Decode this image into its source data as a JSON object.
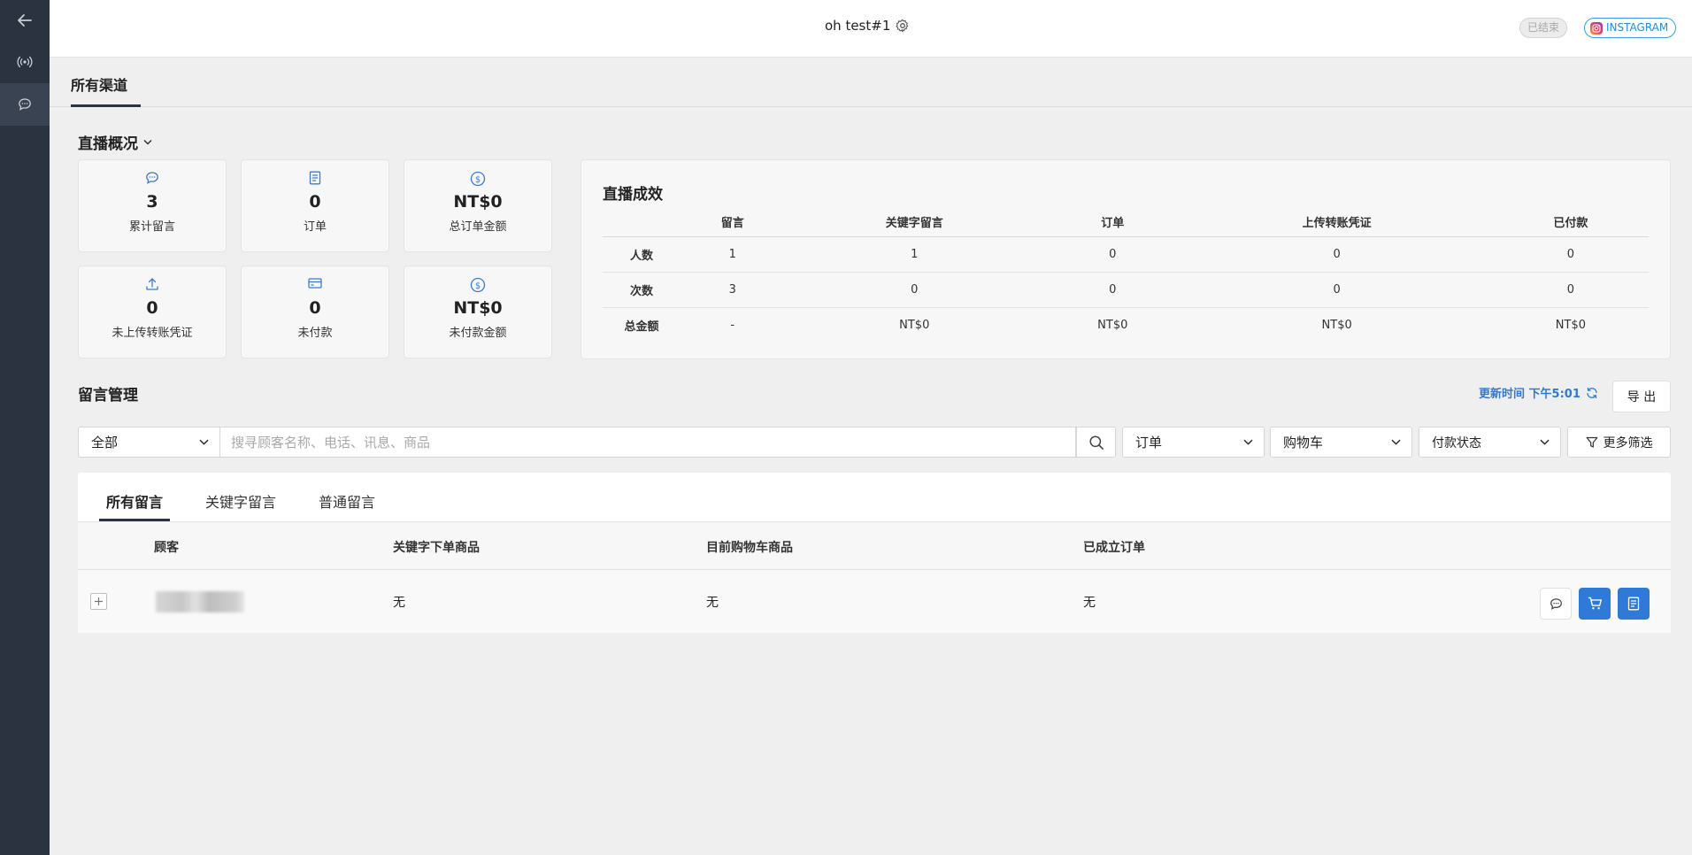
{
  "header": {
    "title": "oh test#1",
    "status_badge": "已结束",
    "platform_badge": "INSTAGRAM"
  },
  "channel_tabs": [
    "所有渠道"
  ],
  "overview": {
    "title": "直播概况",
    "stats": [
      {
        "icon": "comment-icon",
        "value": "3",
        "label": "累计留言"
      },
      {
        "icon": "order-icon",
        "value": "0",
        "label": "订单"
      },
      {
        "icon": "dollar-icon",
        "value": "NT$0",
        "label": "总订单金额"
      },
      {
        "icon": "upload-icon",
        "value": "0",
        "label": "未上传转账凭证"
      },
      {
        "icon": "card-icon",
        "value": "0",
        "label": "未付款"
      },
      {
        "icon": "dollar-icon",
        "value": "NT$0",
        "label": "未付款金额"
      }
    ]
  },
  "performance": {
    "title": "直播成效",
    "columns": [
      "留言",
      "关键字留言",
      "订单",
      "上传转账凭证",
      "已付款"
    ],
    "rows": [
      {
        "label": "人数",
        "values": [
          "1",
          "1",
          "0",
          "0",
          "0"
        ]
      },
      {
        "label": "次数",
        "values": [
          "3",
          "0",
          "0",
          "0",
          "0"
        ]
      },
      {
        "label": "总金额",
        "values": [
          "-",
          "NT$0",
          "NT$0",
          "NT$0",
          "NT$0"
        ]
      }
    ]
  },
  "comments": {
    "title": "留言管理",
    "update_time": "更新时间 下午5:01",
    "export_label": "导 出",
    "filters": {
      "scope": "全部",
      "search_placeholder": "搜寻顾客名称、电话、讯息、商品",
      "order": "订单",
      "cart": "购物车",
      "payment": "付款状态",
      "more": "更多筛选"
    },
    "tabs": [
      "所有留言",
      "关键字留言",
      "普通留言"
    ],
    "columns": [
      "顾客",
      "关键字下单商品",
      "目前购物车商品",
      "已成立订单"
    ],
    "rows": [
      {
        "keyword_items": "无",
        "cart_items": "无",
        "orders": "无"
      }
    ]
  },
  "colors": {
    "sidebar": "#2b3340",
    "accent": "#2f7ad6",
    "background": "#efefef"
  }
}
